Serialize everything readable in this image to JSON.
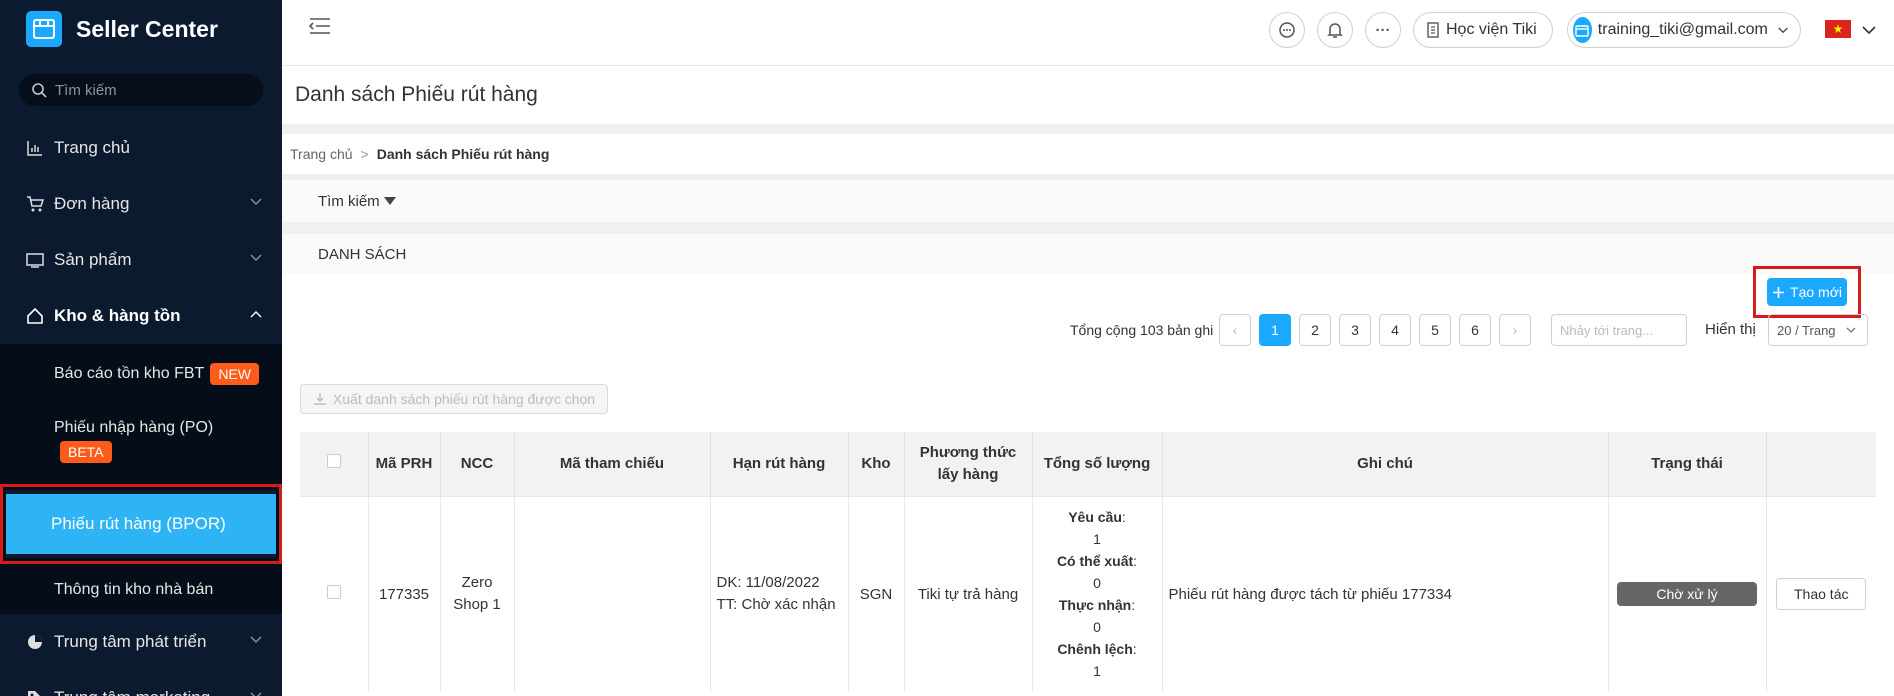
{
  "brand": {
    "title": "Seller Center"
  },
  "sidebar": {
    "search_placeholder": "Tìm kiếm",
    "items": [
      {
        "label": "Trang chủ"
      },
      {
        "label": "Đơn hàng"
      },
      {
        "label": "Sản phẩm"
      },
      {
        "label": "Kho & hàng tồn"
      },
      {
        "label": "Trung tâm phát triển"
      },
      {
        "label": "Trung tâm marketing"
      }
    ],
    "sub_items": [
      {
        "label": "Báo cáo tồn kho FBT",
        "badge": "NEW"
      },
      {
        "label": "Phiếu nhập hàng (PO)",
        "badge": "BETA"
      },
      {
        "label": "Phiếu rút hàng (BPOR)"
      },
      {
        "label": "Thông tin kho nhà bán"
      }
    ]
  },
  "header": {
    "academy_label": "Học viện Tiki",
    "user_email": "training_tiki@gmail.com",
    "more_label": "···",
    "flag_star": "★"
  },
  "page": {
    "title": "Danh sách Phiếu rút hàng",
    "breadcrumb_home": "Trang chủ",
    "breadcrumb_sep": ">",
    "breadcrumb_current": "Danh sách Phiếu rút hàng",
    "search_label": "Tìm kiếm",
    "list_label": "DANH SÁCH",
    "create_label": "Tạo mới",
    "total_text": "Tổng cộng 103 bản ghi",
    "pages": [
      "1",
      "2",
      "3",
      "4",
      "5",
      "6"
    ],
    "prev_arrow": "‹",
    "next_arrow": "›",
    "jump_placeholder": "Nhảy tới trang...",
    "show_label": "Hiển thị",
    "page_size": "20 / Trang",
    "export_label": "Xuất danh sách phiếu rút hàng được chọn"
  },
  "table": {
    "headers": [
      "Mã PRH",
      "NCC",
      "Mã tham chiếu",
      "Hạn rút hàng",
      "Kho",
      "Phương thức lấy hàng",
      "Tổng số lượng",
      "Ghi chú",
      "Trạng thái"
    ],
    "row": {
      "id": "177335",
      "ncc_line1": "Zero",
      "ncc_line2": "Shop 1",
      "ref": "",
      "deadline_dk": "DK: 11/08/2022",
      "deadline_tt": "TT: Chờ xác nhận",
      "warehouse": "SGN",
      "method": "Tiki tự trả hàng",
      "qty_requested_label": "Yêu cầu",
      "qty_requested": "1",
      "qty_available_label": "Có thể xuất",
      "qty_available": "0",
      "qty_received_label": "Thực nhận",
      "qty_received": "0",
      "qty_diff_label": "Chênh lệch",
      "qty_diff": "1",
      "colon": ":",
      "note": "Phiếu rút hàng được tách từ phiếu 177334",
      "status": "Chờ xử lý",
      "action": "Thao tác"
    }
  }
}
